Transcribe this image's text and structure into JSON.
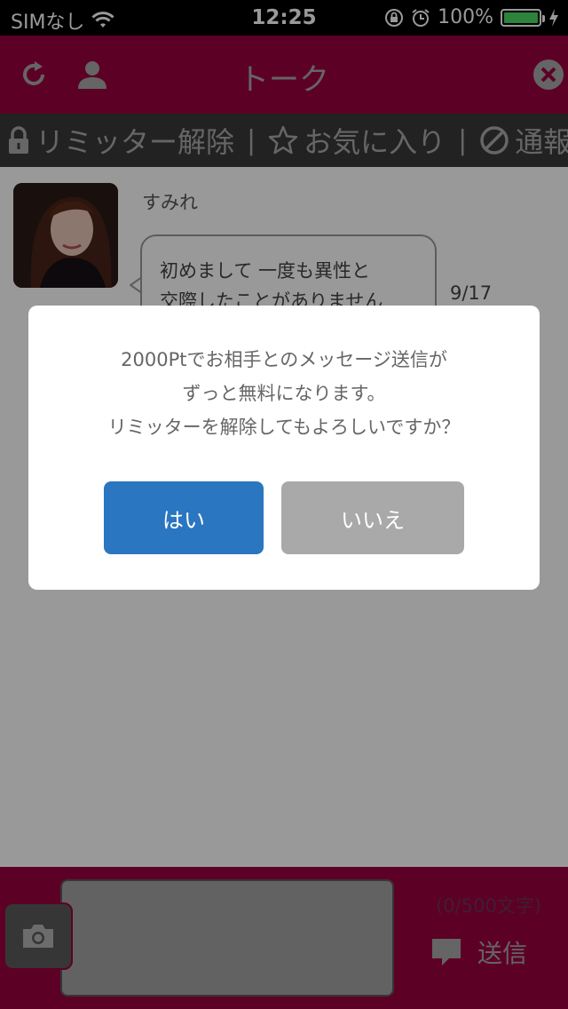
{
  "status_bar": {
    "carrier": "SIMなし",
    "time": "12:25",
    "battery_percent": "100%",
    "battery_level": 1.0
  },
  "header": {
    "title": "トーク",
    "left_icons": [
      "refresh-icon",
      "person-icon"
    ],
    "right_icon": "close-icon"
  },
  "toolbar": {
    "limiter_release": "リミッター解除",
    "favorite": "お気に入り",
    "report": "通報",
    "separator": "|"
  },
  "chat": {
    "sender_name": "すみれ",
    "message_lines": [
      "初めまして 一度も異性と",
      "交際したことがありません"
    ],
    "date": "9/17"
  },
  "dialog": {
    "message_lines": [
      "2000Ptでお相手とのメッセージ送信が",
      "ずっと無料になります。",
      "リミッターを解除してもよろしいですか？"
    ],
    "yes_label": "はい",
    "no_label": "いいえ"
  },
  "composer": {
    "char_count": "(0/500文字)",
    "send_label": "送信"
  },
  "colors": {
    "brand": "#9c0040",
    "toolbar_bg": "#3a3a3a",
    "yes_button": "#2a76c0",
    "no_button": "#a9a9a9",
    "battery_green": "#4cd964"
  }
}
